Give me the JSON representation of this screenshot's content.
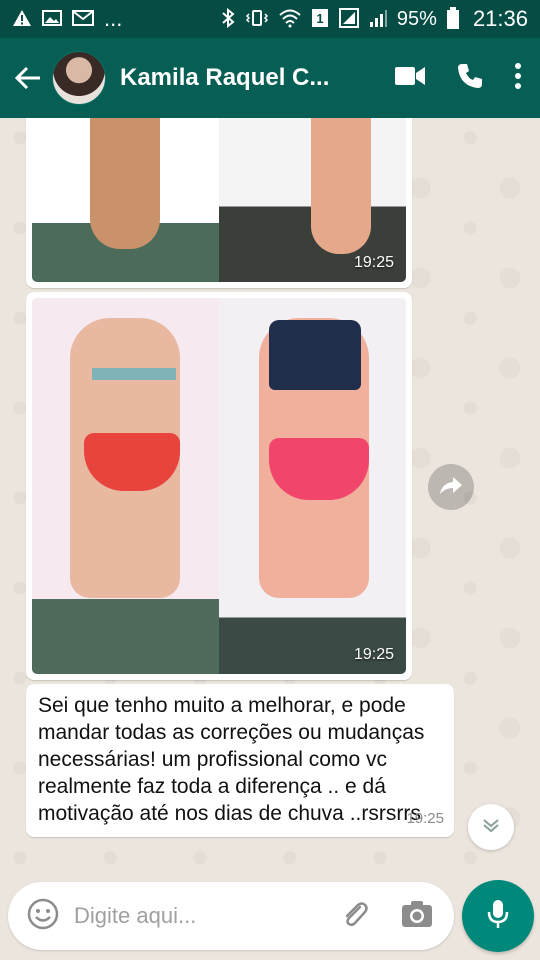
{
  "status_bar": {
    "notification_icons": [
      "warning-icon",
      "image-icon",
      "gmail-icon"
    ],
    "more_indicator": "...",
    "battery_percent": "95%",
    "time": "21:36"
  },
  "header": {
    "contact_name": "Kamila Raquel C..."
  },
  "messages": [
    {
      "type": "image",
      "time": "19:25"
    },
    {
      "type": "image",
      "time": "19:25"
    },
    {
      "type": "text",
      "text": "Sei que tenho muito a melhorar, e pode mandar todas as correções ou mudanças necessárias!  um profissional como vc realmente faz toda a diferença .. e dá motivação até nos dias de chuva ..rsrsrrs",
      "time": "19:25"
    }
  ],
  "composer": {
    "placeholder": "Digite aqui..."
  },
  "colors": {
    "app_bar": "#075e54",
    "status_bar": "#054d44",
    "fab": "#00897b",
    "chat_bg": "#ece5dd"
  }
}
